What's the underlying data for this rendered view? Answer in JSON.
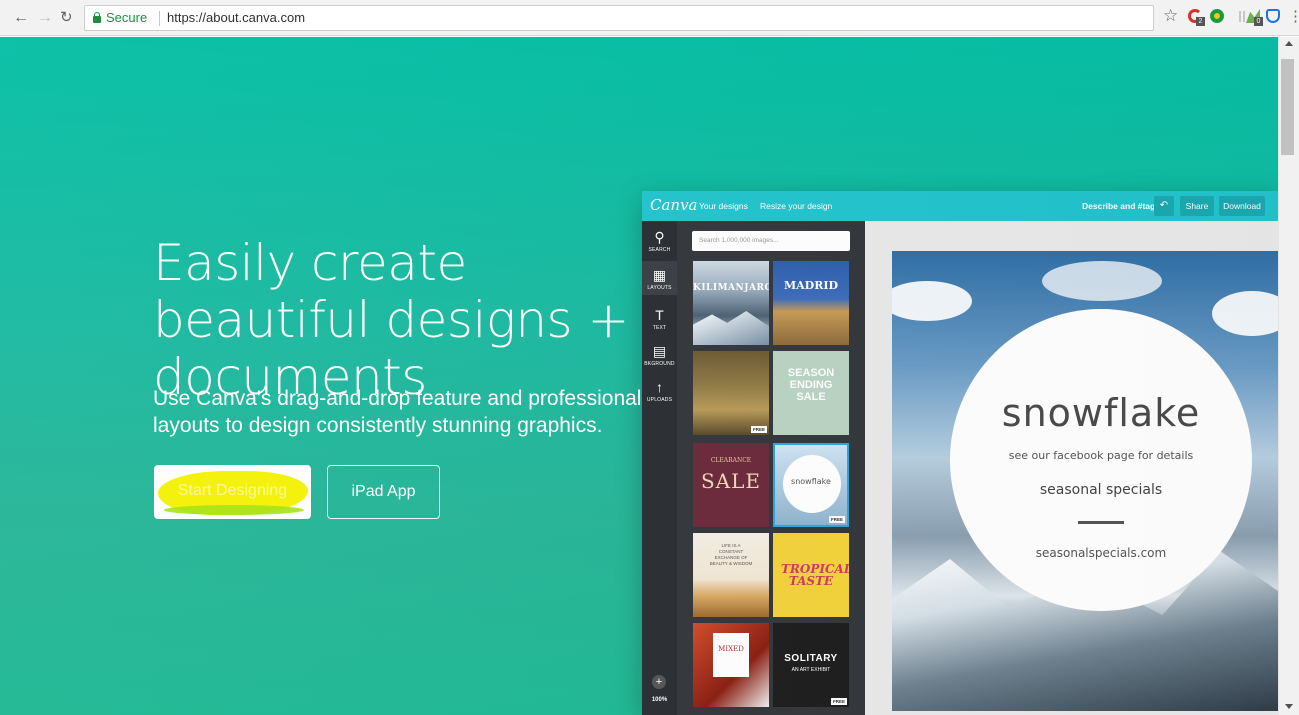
{
  "browser": {
    "secure_label": "Secure",
    "url": "https://about.canva.com",
    "ext_g_badge": "2",
    "ext_p_badge": "0"
  },
  "hero": {
    "title": "Easily create beautiful designs + documents",
    "subtitle": "Use Canva's drag-and-drop feature and professional layouts to design consistently stunning graphics.",
    "start_button": "Start Designing",
    "ipad_button": "iPad App",
    "accent": "#05bfa4",
    "highlight_color": "#f4f20c"
  },
  "editor": {
    "logo": "Canva",
    "nav": [
      "Your designs",
      "Resize your design"
    ],
    "describe": "Describe and #tag",
    "share": "Share",
    "download": "Download",
    "rail": [
      {
        "icon": "search-icon",
        "label": "SEARCH"
      },
      {
        "icon": "layouts-icon",
        "label": "LAYOUTS"
      },
      {
        "icon": "text-icon",
        "label": "TEXT"
      },
      {
        "icon": "background-icon",
        "label": "BKGROUND"
      },
      {
        "icon": "uploads-icon",
        "label": "UPLOADS"
      }
    ],
    "zoom": "100%",
    "search_placeholder": "Search 1,000,000 images...",
    "thumbs": {
      "kili": "KILIMANJARO",
      "madrid": "MADRID",
      "season": "SEASON ENDING SALE",
      "clearance_top": "CLEARANCE",
      "clearance": "SALE",
      "snow": "snowflake",
      "life": "LIFE IS A CONSTANT EXCHANGE OF BEAUTY & WISDOM",
      "tropical": "TROPICAL TASTE",
      "mixed": "MIXED",
      "solitary": "SOLITARY",
      "solitary_sub": "AN ART EXHIBIT",
      "free": "FREE"
    },
    "canvas": {
      "title": "snowflake",
      "subtitle": "see our facebook page for details",
      "specials": "seasonal specials",
      "url": "seasonalspecials.com"
    }
  }
}
